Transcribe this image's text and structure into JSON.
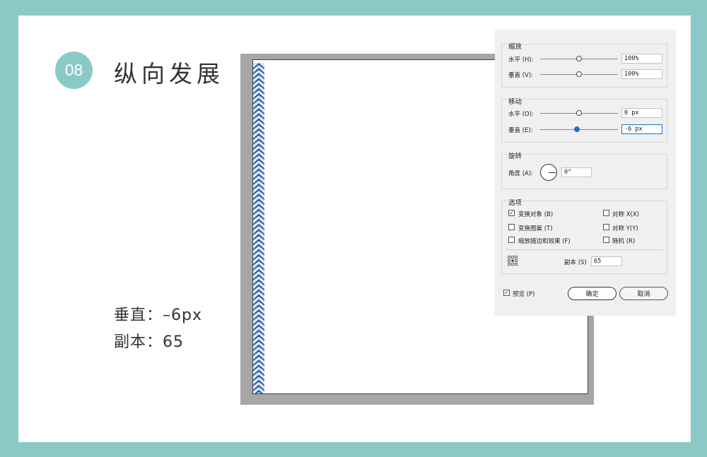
{
  "tutorial": {
    "step_number": "08",
    "step_title": "纵向发展",
    "note_vertical": "垂直：–6px",
    "note_copies": "副本：65"
  },
  "colors": {
    "background": "#8bc9c7",
    "pattern": "#1f57a8",
    "accent": "#1a6fd4"
  },
  "dialog": {
    "scale": {
      "title": "缩放",
      "horizontal_label": "水平 (H):",
      "horizontal_value": "100%",
      "vertical_label": "垂直 (V):",
      "vertical_value": "100%"
    },
    "move": {
      "title": "移动",
      "horizontal_label": "水平 (O):",
      "horizontal_value": "0 px",
      "vertical_label": "垂直 (E):",
      "vertical_value": "-6 px"
    },
    "rotate": {
      "title": "旋转",
      "angle_label": "角度 (A):",
      "angle_value": "0°"
    },
    "options": {
      "title": "选项",
      "transform_objects": "变换对象 (B)",
      "transform_objects_checked": true,
      "transform_patterns": "变换图案 (T)",
      "transform_patterns_checked": false,
      "scale_strokes": "缩放描边和效果 (F)",
      "scale_strokes_checked": false,
      "reflect_x": "对称 X(X)",
      "reflect_x_checked": false,
      "reflect_y": "对称 Y(Y)",
      "reflect_y_checked": false,
      "random": "随机 (R)",
      "random_checked": false,
      "copies_label": "副本 (S)",
      "copies_value": "65"
    },
    "preview_label": "预览 (P)",
    "preview_checked": true,
    "ok_label": "确定",
    "cancel_label": "取消"
  }
}
